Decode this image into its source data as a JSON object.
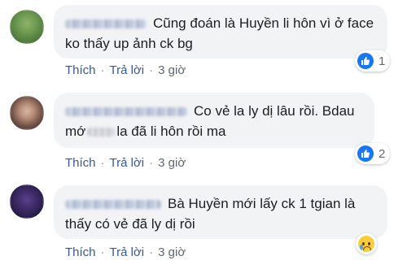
{
  "colors": {
    "link": "#365899",
    "meta": "#606770",
    "bubble": "#f2f3f5",
    "like": "#1877f2"
  },
  "comments": [
    {
      "text": "Cũng đoán là Huyền li hôn vì ở face ko thấy up ảnh ck bg",
      "reaction": {
        "icon": "like-icon",
        "count": "1"
      },
      "like_label": "Thích",
      "reply_label": "Trả lời",
      "time": "3 giờ"
    },
    {
      "text_part1": "Co vẻ la ly dị lâu rồi. Bdau mớ",
      "text_part2": "la đã li hôn rồi ma",
      "reaction": {
        "icon": "like-icon",
        "count": "2"
      },
      "like_label": "Thích",
      "reply_label": "Trả lời",
      "time": "3 giờ"
    },
    {
      "text": "Bà Huyền mới lấy ck 1 tgian là thấy có vẻ đã ly dị rồi",
      "reaction": {
        "icon": "sad-icon",
        "count": ""
      },
      "like_label": "Thích",
      "reply_label": "Trả lời",
      "time": "3 giờ"
    }
  ],
  "separator": "·"
}
